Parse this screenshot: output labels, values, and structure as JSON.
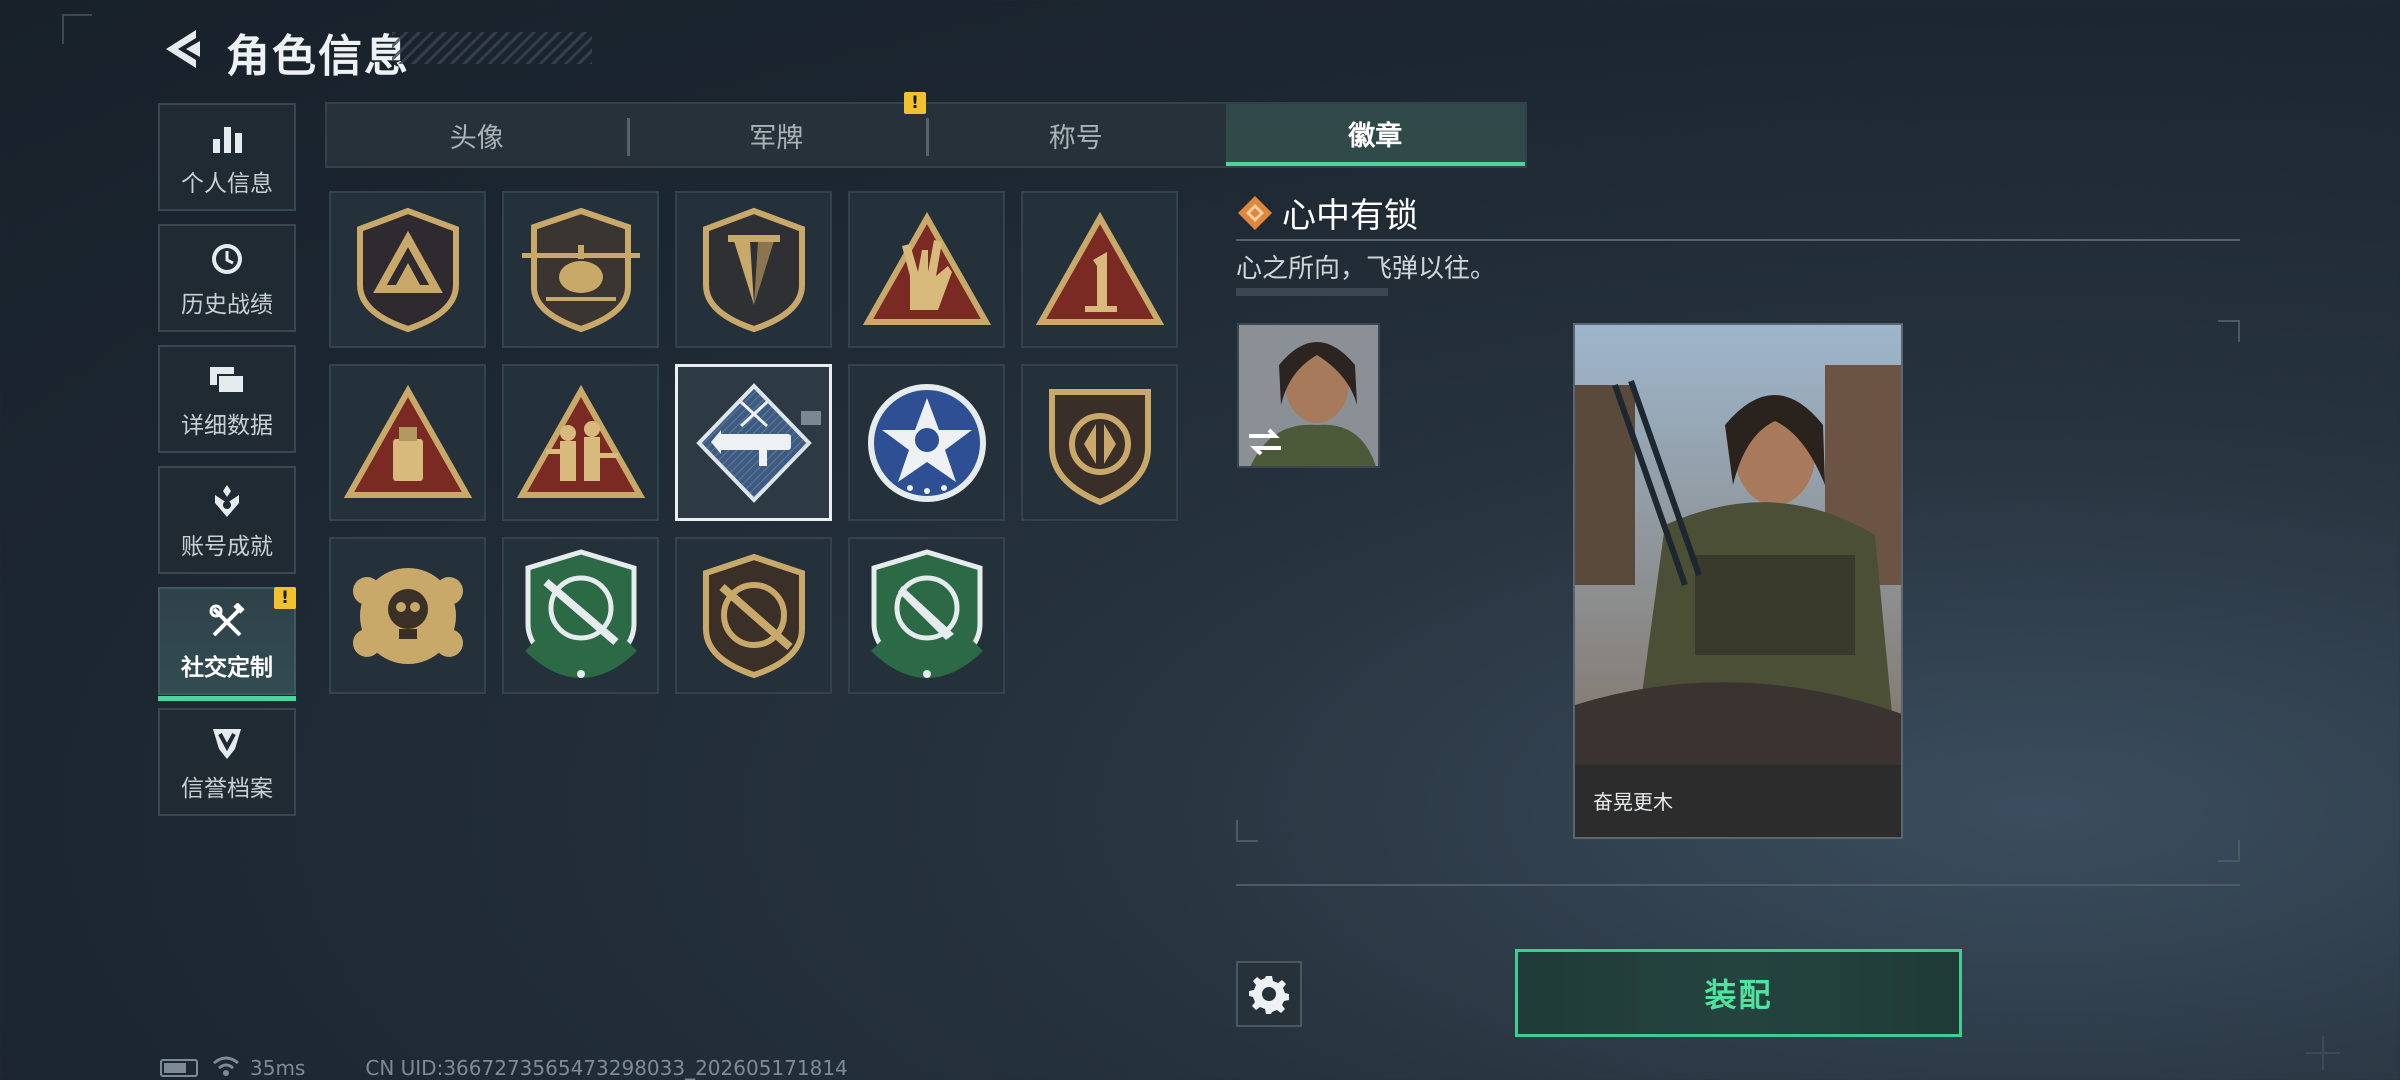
{
  "header": {
    "title": "角色信息"
  },
  "sidebar": {
    "items": [
      {
        "label": "个人信息",
        "icon": "bar-chart-icon",
        "active": false
      },
      {
        "label": "历史战绩",
        "icon": "clock-icon",
        "active": false
      },
      {
        "label": "详细数据",
        "icon": "stack-icon",
        "active": false
      },
      {
        "label": "账号成就",
        "icon": "achievement-icon",
        "active": false
      },
      {
        "label": "社交定制",
        "icon": "tools-icon",
        "active": true,
        "badge": "!"
      },
      {
        "label": "信誉档案",
        "icon": "shield-v-icon",
        "active": false
      }
    ]
  },
  "tabs": [
    {
      "label": "头像",
      "active": false
    },
    {
      "label": "军牌",
      "active": false,
      "badge": "!"
    },
    {
      "label": "称号",
      "active": false
    },
    {
      "label": "徽章",
      "active": true
    }
  ],
  "badges": [
    {
      "name": "triangle-shield-badge",
      "selected": false
    },
    {
      "name": "helicopter-badge",
      "selected": false
    },
    {
      "name": "dagger-shield-badge",
      "selected": false
    },
    {
      "name": "rock-hand-badge",
      "selected": false
    },
    {
      "name": "number-one-badge",
      "selected": false
    },
    {
      "name": "usb-triangle-badge",
      "selected": false
    },
    {
      "name": "soldiers-triangle-badge",
      "selected": false
    },
    {
      "name": "rocket-launcher-badge",
      "selected": true
    },
    {
      "name": "star-skull-badge",
      "selected": false
    },
    {
      "name": "arrows-shield-badge",
      "selected": false
    },
    {
      "name": "crossed-skull-badge",
      "selected": false
    },
    {
      "name": "green-rifle-badge",
      "selected": false
    },
    {
      "name": "gold-rifle-badge",
      "selected": false
    },
    {
      "name": "green-knife-badge",
      "selected": false
    }
  ],
  "detail": {
    "title": "心中有锁",
    "description": "心之所向，飞弹以往。",
    "character_name": "奋晃更木"
  },
  "actions": {
    "equip_label": "装配"
  },
  "status": {
    "ping": "35ms",
    "uid": "CN UID:3667273565473298033_202605171814"
  },
  "colors": {
    "accent": "#4cd69a",
    "warning": "#f2c12e",
    "badge_gold": "#c9a96a"
  }
}
